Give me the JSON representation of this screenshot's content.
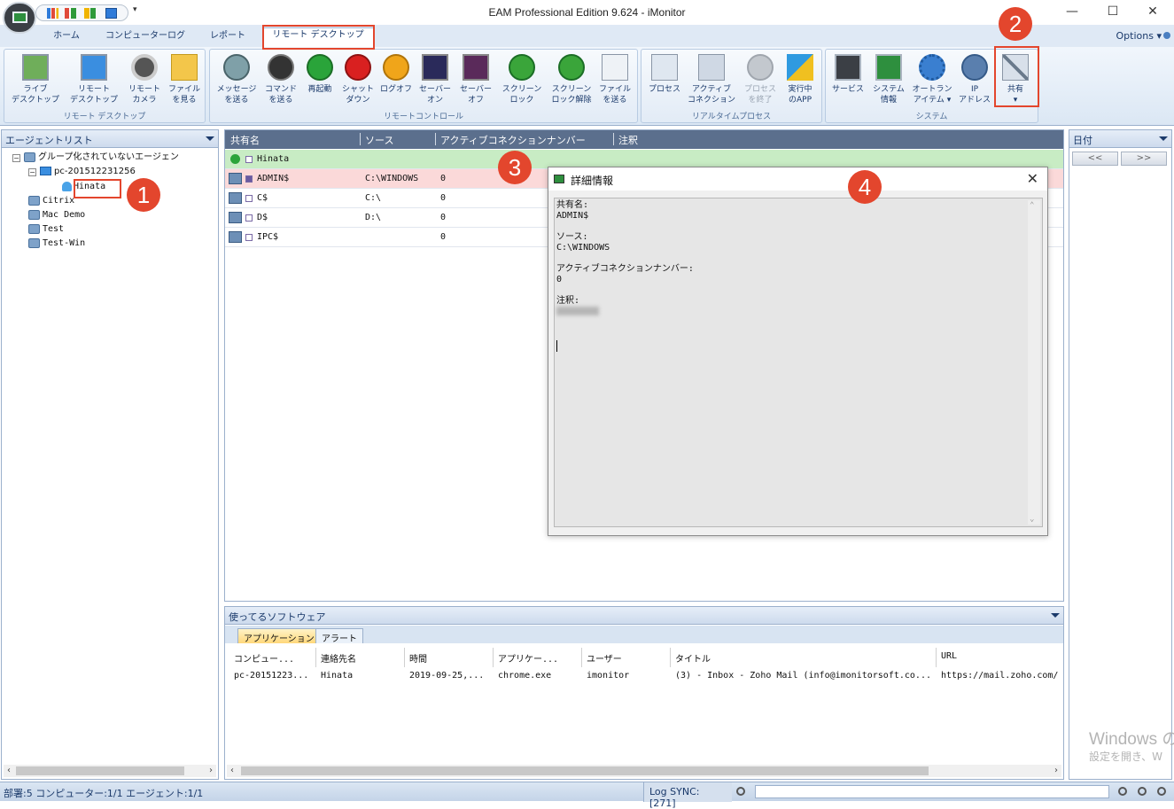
{
  "window": {
    "title": "EAM Professional Edition 9.624 - iMonitor",
    "minimize": "—",
    "maximize": "☐",
    "close": "✕"
  },
  "tabs": {
    "home": "ホーム",
    "computer_log": "コンピューターログ",
    "report": "レポート",
    "remote_desktop": "リモート デスクトップ",
    "options": "Options"
  },
  "ribbon": {
    "groups": {
      "remote_desktop": "リモート デスクトップ",
      "remote_control": "リモートコントロール",
      "realtime_process": "リアルタイムプロセス",
      "system": "システム"
    },
    "buttons": {
      "live_desktop": [
        "ライブ",
        "デスクトップ"
      ],
      "remote_desktop": [
        "リモート",
        "デスクトップ"
      ],
      "remote_camera": [
        "リモート",
        "カメラ"
      ],
      "view_files": [
        "ファイル",
        "を見る"
      ],
      "send_message": [
        "メッセージ",
        "を送る"
      ],
      "send_command": [
        "コマンド",
        "を送る"
      ],
      "restart": [
        "再起動",
        ""
      ],
      "shutdown": [
        "シャット",
        "ダウン"
      ],
      "logoff": [
        "ログオフ",
        ""
      ],
      "monitor_on": [
        "セーバー",
        "オン"
      ],
      "monitor_off": [
        "セーバー",
        "オフ"
      ],
      "screen_lock": [
        "スクリーン",
        "ロック"
      ],
      "screen_unlock": [
        "スクリーン",
        "ロック解除"
      ],
      "send_file": [
        "ファイル",
        "を送る"
      ],
      "process": [
        "プロセス",
        ""
      ],
      "active_connection": [
        "アクティブ",
        "コネクション"
      ],
      "end_process": [
        "プロセス",
        "を終了"
      ],
      "running_app": [
        "実行中",
        "のAPP"
      ],
      "service": [
        "サービス",
        ""
      ],
      "system_info": [
        "システム",
        "情報"
      ],
      "autorun": [
        "オートラン",
        "アイテム ▾"
      ],
      "ip_address": [
        "IP",
        "アドレス"
      ],
      "share": [
        "共有",
        "▾"
      ]
    }
  },
  "agent_list": {
    "title": "エージェントリスト",
    "tree": [
      {
        "label": "グループ化されていないエージェン"
      },
      {
        "label": "pc-201512231256"
      },
      {
        "label": "Hinata"
      },
      {
        "label": "Citrix"
      },
      {
        "label": "Mac Demo"
      },
      {
        "label": "Test"
      },
      {
        "label": "Test-Win"
      }
    ]
  },
  "shares": {
    "columns": [
      "共有名",
      "ソース",
      "アクティブコネクションナンバー",
      "注釈"
    ],
    "group_row": "Hinata",
    "rows": [
      {
        "name": "ADMIN$",
        "source": "C:\\WINDOWS",
        "connections": "0"
      },
      {
        "name": "C$",
        "source": "C:\\",
        "connections": "0"
      },
      {
        "name": "D$",
        "source": "D:\\",
        "connections": "0"
      },
      {
        "name": "IPC$",
        "source": "",
        "connections": "0"
      }
    ]
  },
  "detail": {
    "title": "詳細情報",
    "share_name_label": "共有名:",
    "share_name": "ADMIN$",
    "source_label": "ソース:",
    "source": "C:\\WINDOWS",
    "connections_label": "アクティブコネクションナンバー:",
    "connections": "0",
    "note_label": "注釈:"
  },
  "software": {
    "title": "使ってるソフトウェア",
    "tabs": [
      "アプリケーション",
      "アラート"
    ],
    "columns": [
      "コンピュー...",
      "連絡先名",
      "時間",
      "アプリケー...",
      "ユーザー",
      "タイトル",
      "URL"
    ],
    "rows": [
      [
        "pc-20151223...",
        "Hinata",
        "2019-09-25,...",
        "chrome.exe",
        "imonitor",
        "(3) - Inbox - Zoho Mail (info@imonitorsoft.co...",
        "https://mail.zoho.com/:"
      ]
    ]
  },
  "date_panel": {
    "title": "日付",
    "prev": "<<",
    "next": ">>",
    "watermark_line1": "Windows の",
    "watermark_line2": "設定を開き、W"
  },
  "callouts": [
    "1",
    "2",
    "3",
    "4"
  ],
  "statusbar": {
    "summary": "部署:5 コンピューター:1/1 エージェント:1/1",
    "log_sync": "Log SYNC: [271]"
  },
  "colors": {
    "accent_red": "#e3462d",
    "header_blue": "#5b6f8d",
    "group_row_green": "#c8ecc4",
    "selected_row_pink": "#fbd9d9"
  }
}
